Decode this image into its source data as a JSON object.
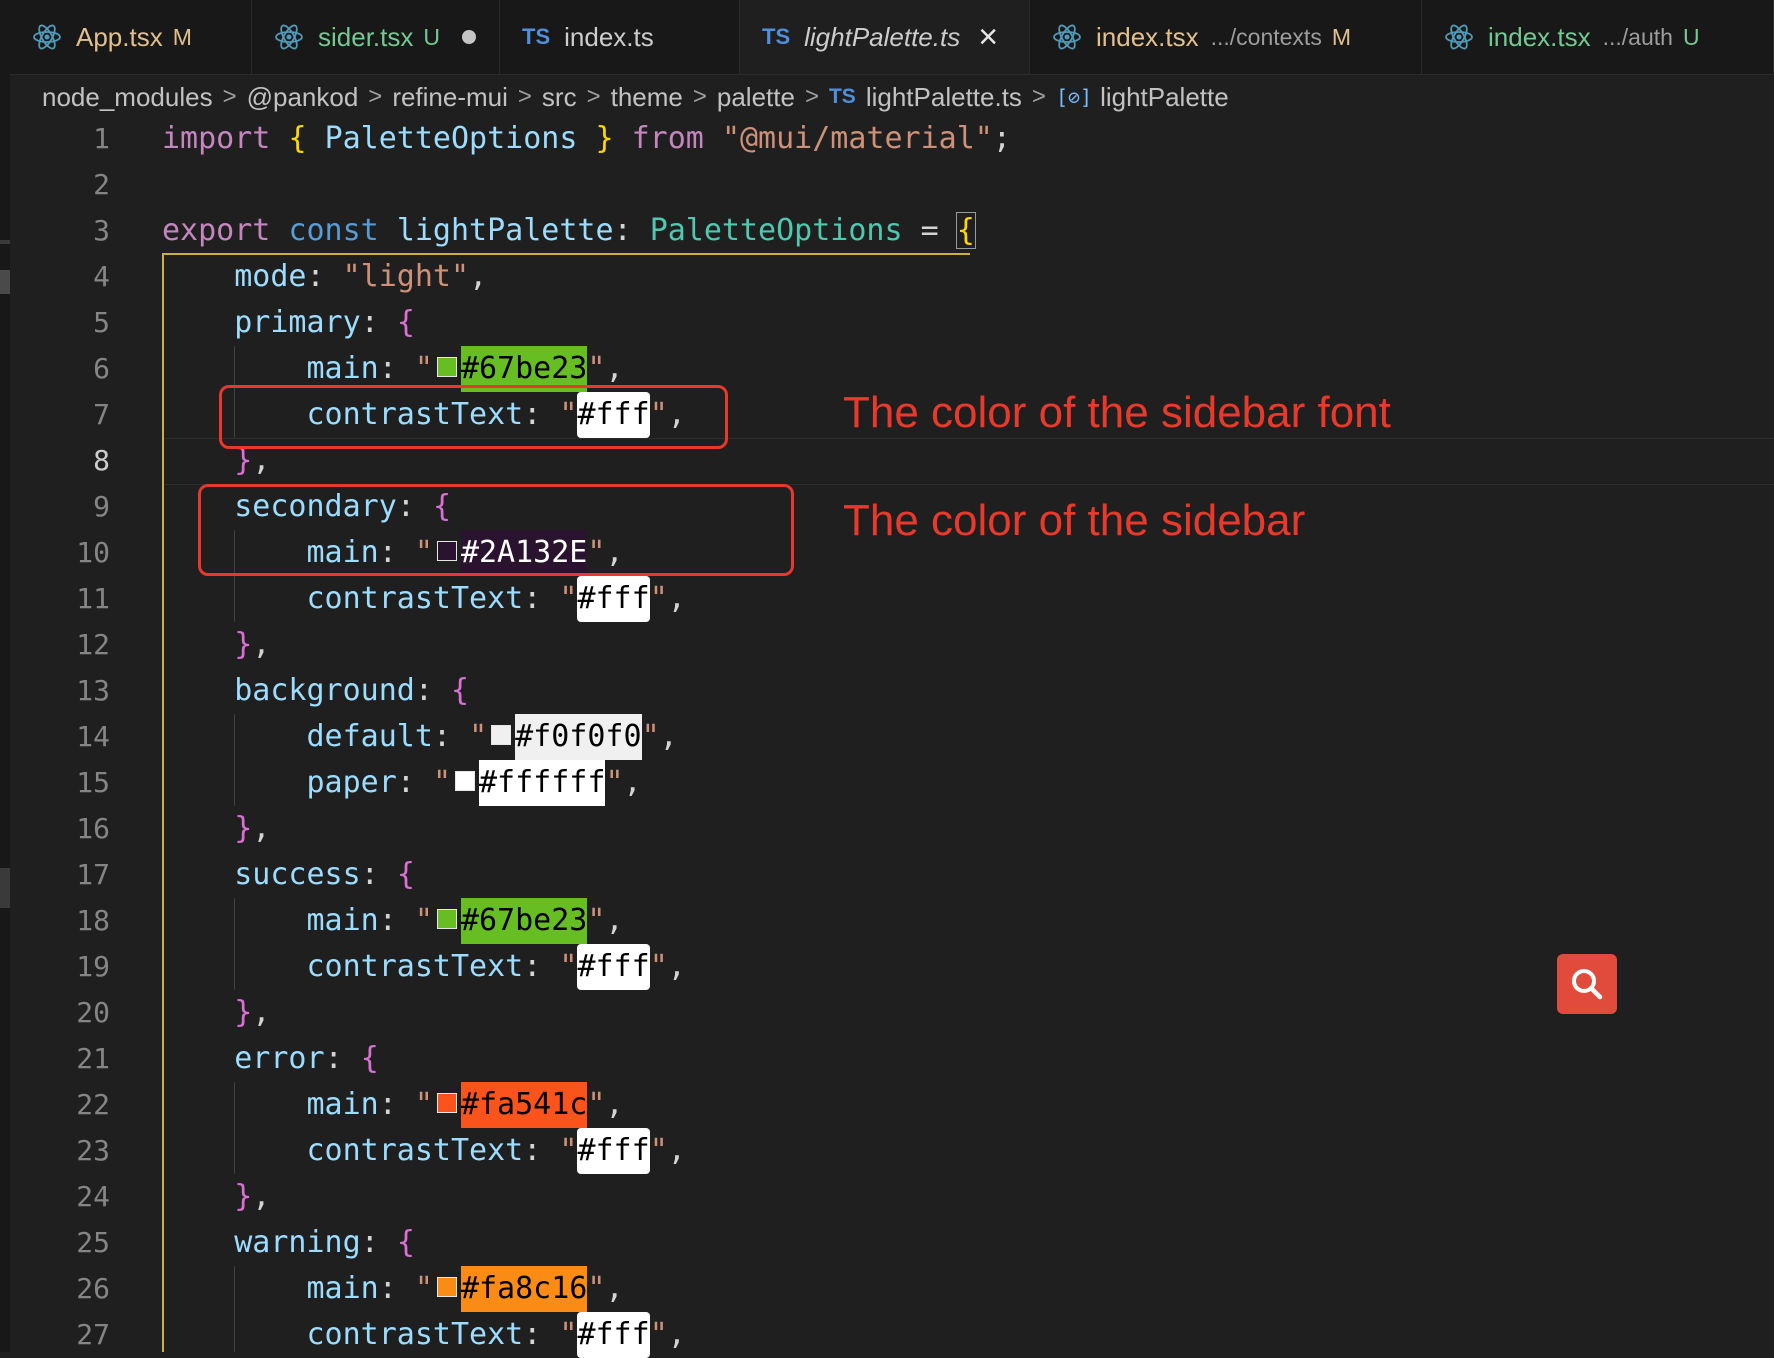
{
  "tabs": [
    {
      "name": "App.tsx",
      "status": "M",
      "icon": "react-icon",
      "state": "modified"
    },
    {
      "name": "sider.tsx",
      "status": "U",
      "icon": "react-icon",
      "state": "untracked",
      "unsaved": true
    },
    {
      "name": "index.ts",
      "icon": "typescript-icon",
      "icon_text": "TS"
    },
    {
      "name": "lightPalette.ts",
      "icon": "typescript-icon",
      "icon_text": "TS",
      "active": true
    },
    {
      "name": "index.tsx",
      "description": ".../contexts",
      "status": "M",
      "icon": "react-icon",
      "state": "modified"
    },
    {
      "name": "index.tsx",
      "description": ".../auth",
      "status": "U",
      "icon": "react-icon",
      "state": "untracked"
    }
  ],
  "breadcrumb": {
    "items": [
      "node_modules",
      "@pankod",
      "refine-mui",
      "src",
      "theme",
      "palette",
      "lightPalette.ts",
      "lightPalette"
    ],
    "file_icon_text": "TS",
    "symbol_icon_text": "[⊘]"
  },
  "editor": {
    "line_numbers": [
      "1",
      "2",
      "3",
      "4",
      "5",
      "6",
      "7",
      "8",
      "9",
      "10",
      "11",
      "12",
      "13",
      "14",
      "15",
      "16",
      "17",
      "18",
      "19",
      "20",
      "21",
      "22",
      "23",
      "24",
      "25",
      "26",
      "27"
    ],
    "current_line": 8,
    "tokens": {
      "l1": [
        "import",
        "{",
        "PaletteOptions",
        "}",
        "from",
        "\"@mui/material\"",
        ";"
      ],
      "l3": [
        "export",
        "const",
        "lightPalette",
        ":",
        "PaletteOptions",
        "=",
        "{"
      ],
      "l4": [
        "mode",
        ":",
        "\"light\"",
        ","
      ],
      "l5": [
        "primary",
        ":",
        "{"
      ],
      "l6": [
        "main",
        ":",
        "\"",
        "#67be23",
        "\"",
        ","
      ],
      "l7": [
        "contrastText",
        ":",
        "\"",
        "#fff",
        "\"",
        ","
      ],
      "l8": [
        "}",
        ","
      ],
      "l9": [
        "secondary",
        ":",
        "{"
      ],
      "l10": [
        "main",
        ":",
        "\"",
        "#2A132E",
        "\"",
        ","
      ],
      "l11": [
        "contrastText",
        ":",
        "\"",
        "#fff",
        "\"",
        ","
      ],
      "l12": [
        "}",
        ","
      ],
      "l13": [
        "background",
        ":",
        "{"
      ],
      "l14": [
        "default",
        ":",
        "\"",
        "#f0f0f0",
        "\"",
        ","
      ],
      "l15": [
        "paper",
        ":",
        "\"",
        "#ffffff",
        "\"",
        ","
      ],
      "l16": [
        "}",
        ","
      ],
      "l17": [
        "success",
        ":",
        "{"
      ],
      "l18": [
        "main",
        ":",
        "\"",
        "#67be23",
        "\"",
        ","
      ],
      "l19": [
        "contrastText",
        ":",
        "\"",
        "#fff",
        "\"",
        ","
      ],
      "l20": [
        "}",
        ","
      ],
      "l21": [
        "error",
        ":",
        "{"
      ],
      "l22": [
        "main",
        ":",
        "\"",
        "#fa541c",
        "\"",
        ","
      ],
      "l23": [
        "contrastText",
        ":",
        "\"",
        "#fff",
        "\"",
        ","
      ],
      "l24": [
        "}",
        ","
      ],
      "l25": [
        "warning",
        ":",
        "{"
      ],
      "l26": [
        "main",
        ":",
        "\"",
        "#fa8c16",
        "\"",
        ","
      ],
      "l27": [
        "contrastText",
        ":",
        "\"",
        "#fff",
        "\"",
        ","
      ]
    }
  },
  "annotations": {
    "sidebar_font": "The color of the sidebar font",
    "sidebar": "The color of the sidebar"
  },
  "colors": {
    "primary": "#67be23",
    "secondary": "#2A132E",
    "background_default": "#f0f0f0",
    "background_paper": "#ffffff",
    "error": "#fa541c",
    "warning": "#fa8c16",
    "annotation": "#e8372b",
    "search_button": "#e04b3c"
  },
  "search_button": {
    "icon": "search-icon"
  }
}
